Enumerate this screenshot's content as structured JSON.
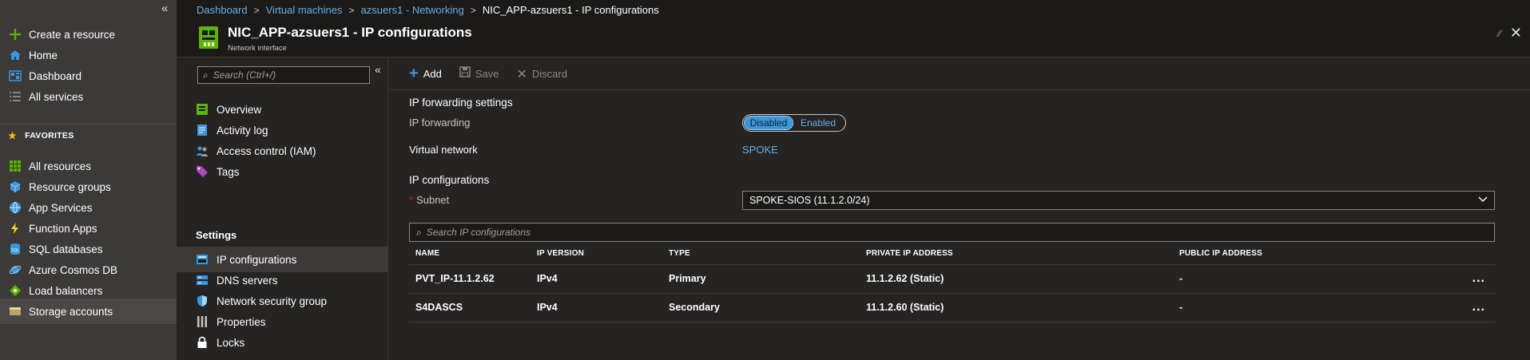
{
  "nav": {
    "items": [
      {
        "label": "Create a resource",
        "icon": "plus-icon"
      },
      {
        "label": "Home",
        "icon": "home-icon"
      },
      {
        "label": "Dashboard",
        "icon": "dashboard-icon"
      },
      {
        "label": "All services",
        "icon": "list-icon"
      },
      {
        "label": "All resources",
        "icon": "grid-icon"
      },
      {
        "label": "Resource groups",
        "icon": "cube-icon"
      },
      {
        "label": "App Services",
        "icon": "globe-icon"
      },
      {
        "label": "Function Apps",
        "icon": "bolt-icon"
      },
      {
        "label": "SQL databases",
        "icon": "sql-icon"
      },
      {
        "label": "Azure Cosmos DB",
        "icon": "cosmos-icon"
      },
      {
        "label": "Load balancers",
        "icon": "diamond-icon"
      },
      {
        "label": "Storage accounts",
        "icon": "storage-icon"
      }
    ],
    "favorites_label": "FAVORITES"
  },
  "breadcrumb": {
    "items": [
      "Dashboard",
      "Virtual machines",
      "azsuers1 - Networking"
    ],
    "current": "NIC_APP-azsuers1 - IP configurations"
  },
  "header": {
    "title": "NIC_APP-azsuers1 - IP configurations",
    "subtitle": "Network interface"
  },
  "resource_menu": {
    "search_placeholder": "Search (Ctrl+/)",
    "items": [
      {
        "label": "Overview",
        "icon": "overview-icon"
      },
      {
        "label": "Activity log",
        "icon": "activity-log-icon"
      },
      {
        "label": "Access control (IAM)",
        "icon": "iam-icon"
      },
      {
        "label": "Tags",
        "icon": "tag-icon"
      }
    ],
    "settings_label": "Settings",
    "settings_items": [
      {
        "label": "IP configurations",
        "icon": "ip-config-icon"
      },
      {
        "label": "DNS servers",
        "icon": "dns-icon"
      },
      {
        "label": "Network security group",
        "icon": "shield-icon"
      },
      {
        "label": "Properties",
        "icon": "properties-icon"
      },
      {
        "label": "Locks",
        "icon": "lock-icon"
      }
    ]
  },
  "toolbar": {
    "add": "Add",
    "save": "Save",
    "discard": "Discard"
  },
  "content": {
    "forwarding_title": "IP forwarding settings",
    "forwarding_label": "IP forwarding",
    "toggle_disabled": "Disabled",
    "toggle_enabled": "Enabled",
    "vnet_label": "Virtual network",
    "vnet_value": "SPOKE",
    "ipconfig_title": "IP configurations",
    "subnet_label": "Subnet",
    "subnet_value": "SPOKE-SIOS (11.1.2.0/24)",
    "ip_search_placeholder": "Search IP configurations"
  },
  "table": {
    "columns": [
      "NAME",
      "IP VERSION",
      "TYPE",
      "PRIVATE IP ADDRESS",
      "PUBLIC IP ADDRESS"
    ],
    "rows": [
      {
        "name": "PVT_IP-11.1.2.62",
        "version": "IPv4",
        "type": "Primary",
        "private_ip": "11.1.2.62 (Static)",
        "public_ip": "-",
        "more": "..."
      },
      {
        "name": "S4DASCS",
        "version": "IPv4",
        "type": "Secondary",
        "private_ip": "11.1.2.60 (Static)",
        "public_ip": "-",
        "more": "..."
      }
    ]
  },
  "colors": {
    "accent": "#3a96dd",
    "link": "#69afe5",
    "background": "#252423",
    "nav": "#3b3a39"
  }
}
